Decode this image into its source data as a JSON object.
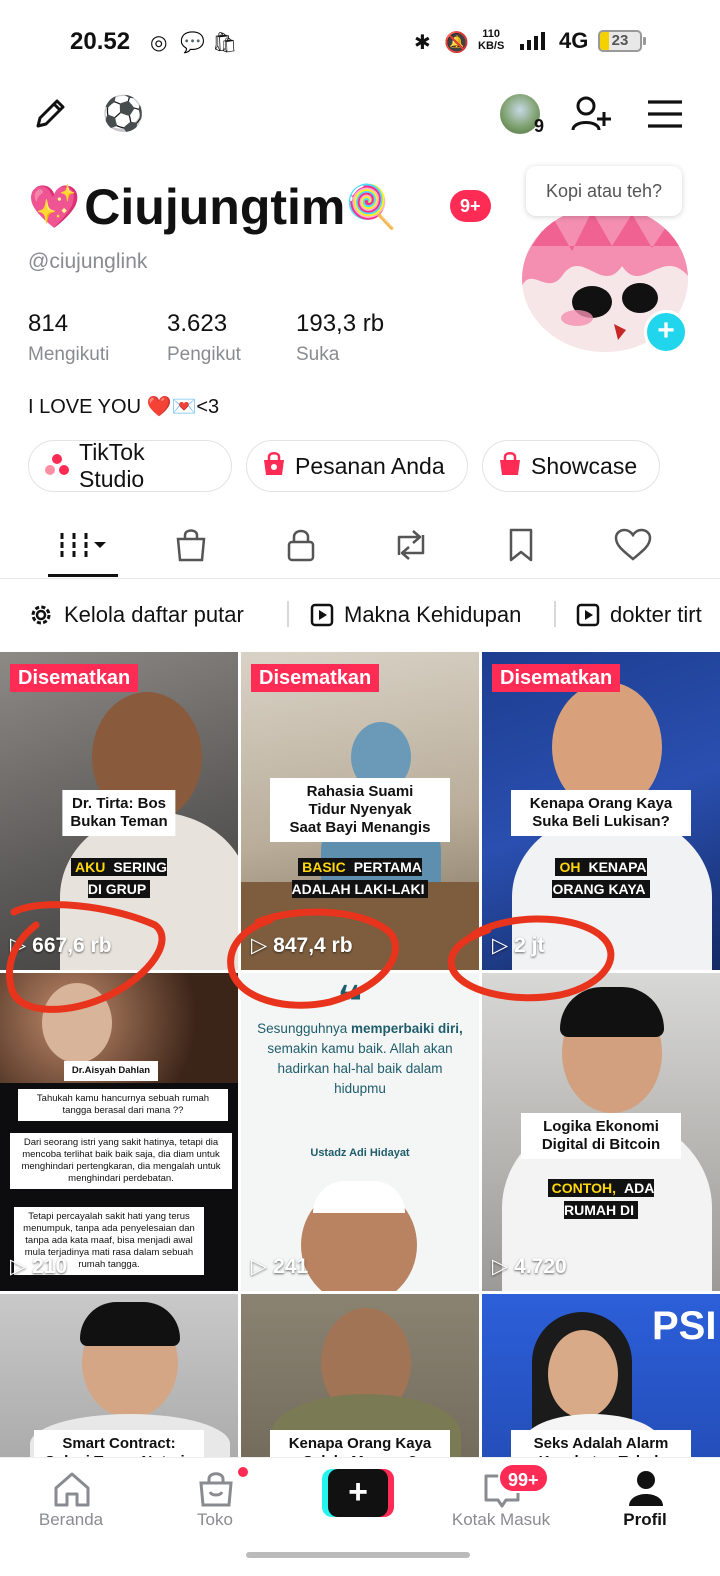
{
  "status_bar": {
    "time": "20.52",
    "net_speed_value": "110",
    "net_speed_unit": "KB/S",
    "network": "4G",
    "battery": "23",
    "battery_fraction": 0.23
  },
  "profile": {
    "display_name": "Ciujungtim",
    "name_badge": "9+",
    "handle": "@ciujunglink",
    "stats": [
      {
        "value": "814",
        "label": "Mengikuti"
      },
      {
        "value": "3.623",
        "label": "Pengikut"
      },
      {
        "value": "193,3 rb",
        "label": "Suka"
      }
    ],
    "bio": "I LOVE YOU ❤️💌<3",
    "note_bubble": "Kopi atau teh?",
    "friends_count": "9"
  },
  "actions": [
    {
      "label": "TikTok Studio",
      "icon": "studio-icon"
    },
    {
      "label": "Pesanan Anda",
      "icon": "orders-bag-icon"
    },
    {
      "label": "Showcase",
      "icon": "showcase-bag-icon"
    }
  ],
  "tabs": [
    {
      "name": "videos-grid-icon",
      "active": true
    },
    {
      "name": "shop-bag-icon",
      "active": false
    },
    {
      "name": "private-lock-icon",
      "active": false
    },
    {
      "name": "repost-icon",
      "active": false
    },
    {
      "name": "bookmark-icon",
      "active": false
    },
    {
      "name": "liked-heart-icon",
      "active": false
    }
  ],
  "playlists": [
    {
      "label": "Kelola daftar putar",
      "icon": "gear-icon"
    },
    {
      "label": "Makna Kehidupan",
      "icon": "playlist-play-icon"
    },
    {
      "label": "dokter tirt",
      "icon": "playlist-play-icon"
    }
  ],
  "videos": [
    {
      "pinned": "Disematkan",
      "title": "Dr. Tirta: Bos\nBukan Teman",
      "caption_hl": "AKU",
      "caption": "SERING\nDI GRUP",
      "views": "667,6 rb"
    },
    {
      "pinned": "Disematkan",
      "title": "Rahasia Suami\nTidur Nyenyak\nSaat Bayi Menangis",
      "caption_hl": "BASIC",
      "caption": "PERTAMA\nADALAH LAKI-LAKI",
      "views": "847,4 rb"
    },
    {
      "pinned": "Disematkan",
      "title": "Kenapa Orang Kaya\nSuka Beli Lukisan?",
      "caption_hl": "OH",
      "caption": "KENAPA\nORANG KAYA",
      "views": "2 jt"
    },
    {
      "title": "Dr.Aisyah Dahlan",
      "note1": "Tahukah kamu hancurnya sebuah rumah tangga berasal dari mana ??",
      "note2": "Dari seorang istri yang sakit hatinya, tetapi dia mencoba terlihat baik baik saja, dia diam untuk menghindari pertengkaran, dia mengalah untuk menghindari perdebatan.",
      "note3": "Tetapi percayalah sakit hati yang terus menumpuk, tanpa ada penyelesaian dan tanpa ada kata maaf, bisa menjadi awal mula terjadinya mati rasa dalam sebuah rumah tangga.",
      "views": "210"
    },
    {
      "quote_start": "Sesungguhnya",
      "quote_bold": "memperbaiki diri,",
      "quote_rest": "semakin kamu baik. Allah akan hadirkan hal-hal baik dalam hidupmu",
      "author": "Ustadz Adi Hidayat",
      "views": "241"
    },
    {
      "title": "Logika Ekonomi\nDigital di Bitcoin",
      "caption_hl": "CONTOH,",
      "caption": "ADA\nRUMAH DI",
      "views": "4.720"
    },
    {
      "title": "Smart Contract:\nSolusi Tanpa Notaris"
    },
    {
      "title": "Kenapa Orang Kaya\nSelalu Menang?"
    },
    {
      "title": "Seks Adalah Alarm\nKesehatan Tubuh",
      "banner": "PSI"
    }
  ],
  "bottom_nav": [
    {
      "label": "Beranda",
      "icon": "home-icon"
    },
    {
      "label": "Toko",
      "icon": "shop-icon"
    },
    {
      "label": "",
      "icon": "create-plus-icon"
    },
    {
      "label": "Kotak Masuk",
      "icon": "inbox-icon",
      "badge": "99+"
    },
    {
      "label": "Profil",
      "icon": "profile-icon",
      "active": true
    }
  ],
  "colors": {
    "accent": "#fe2c55",
    "cyan": "#20d5ec",
    "annotation": "#e8341c"
  }
}
